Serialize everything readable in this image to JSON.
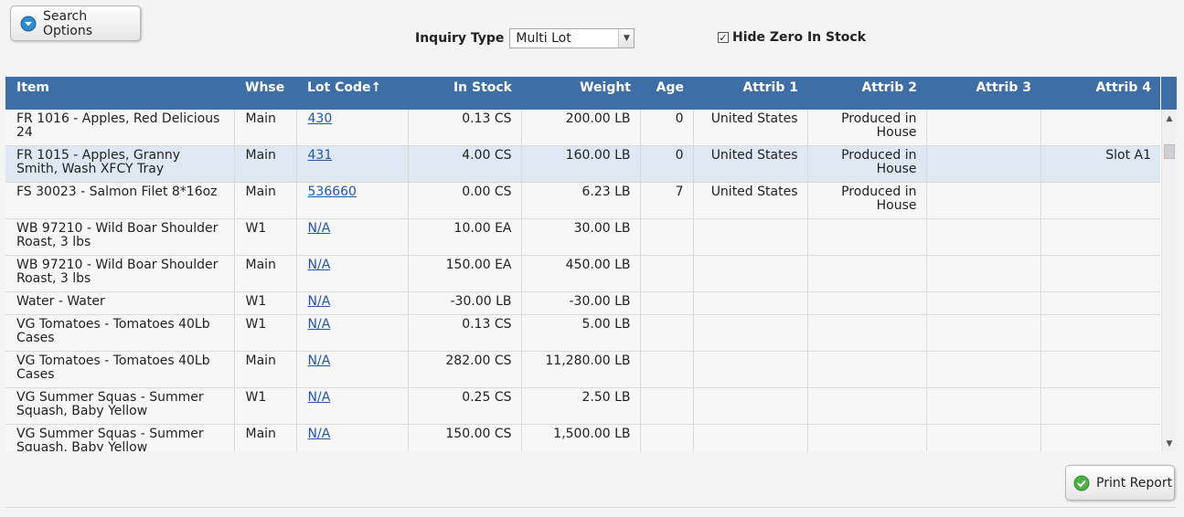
{
  "toolbar": {
    "search_options_label": "Search Options",
    "inquiry_type_label": "Inquiry Type",
    "inquiry_type_value": "Multi Lot",
    "hide_zero_label": "Hide Zero In Stock",
    "hide_zero_checked": true
  },
  "grid": {
    "columns": [
      "Item",
      "Whse",
      "Lot Code↑",
      "In Stock",
      "Weight",
      "Age",
      "Attrib 1",
      "Attrib 2",
      "Attrib 3",
      "Attrib 4"
    ],
    "rows": [
      {
        "item": "FR 1016 - Apples, Red Delicious 24",
        "whse": "Main",
        "lot": "430",
        "in_stock": "0.13 CS",
        "weight": "200.00 LB",
        "age": "0",
        "attrib1": "United States",
        "attrib2": "Produced in House",
        "attrib3": "",
        "attrib4": ""
      },
      {
        "item": "FR 1015 - Apples, Granny Smith, Wash XFCY Tray",
        "whse": "Main",
        "lot": "431",
        "in_stock": "4.00 CS",
        "weight": "160.00 LB",
        "age": "0",
        "attrib1": "United States",
        "attrib2": "Produced in House",
        "attrib3": "",
        "attrib4": "Slot A1"
      },
      {
        "item": "FS 30023 - Salmon Filet 8*16oz",
        "whse": "Main",
        "lot": "536660",
        "in_stock": "0.00 CS",
        "weight": "6.23 LB",
        "age": "7",
        "attrib1": "United States",
        "attrib2": "Produced in House",
        "attrib3": "",
        "attrib4": ""
      },
      {
        "item": "WB 97210 - Wild Boar Shoulder Roast, 3 lbs",
        "whse": "W1",
        "lot": "N/A",
        "in_stock": "10.00 EA",
        "weight": "30.00 LB",
        "age": "",
        "attrib1": "",
        "attrib2": "",
        "attrib3": "",
        "attrib4": ""
      },
      {
        "item": "WB 97210 - Wild Boar Shoulder Roast, 3 lbs",
        "whse": "Main",
        "lot": "N/A",
        "in_stock": "150.00 EA",
        "weight": "450.00 LB",
        "age": "",
        "attrib1": "",
        "attrib2": "",
        "attrib3": "",
        "attrib4": ""
      },
      {
        "item": "Water - Water",
        "whse": "W1",
        "lot": "N/A",
        "in_stock": "-30.00 LB",
        "weight": "-30.00 LB",
        "age": "",
        "attrib1": "",
        "attrib2": "",
        "attrib3": "",
        "attrib4": ""
      },
      {
        "item": "VG Tomatoes - Tomatoes 40Lb Cases",
        "whse": "W1",
        "lot": "N/A",
        "in_stock": "0.13 CS",
        "weight": "5.00 LB",
        "age": "",
        "attrib1": "",
        "attrib2": "",
        "attrib3": "",
        "attrib4": ""
      },
      {
        "item": "VG Tomatoes - Tomatoes 40Lb Cases",
        "whse": "Main",
        "lot": "N/A",
        "in_stock": "282.00 CS",
        "weight": "11,280.00 LB",
        "age": "",
        "attrib1": "",
        "attrib2": "",
        "attrib3": "",
        "attrib4": ""
      },
      {
        "item": "VG Summer Squas - Summer Squash, Baby Yellow",
        "whse": "W1",
        "lot": "N/A",
        "in_stock": "0.25 CS",
        "weight": "2.50 LB",
        "age": "",
        "attrib1": "",
        "attrib2": "",
        "attrib3": "",
        "attrib4": ""
      },
      {
        "item": "VG Summer Squas - Summer Squash, Baby Yellow",
        "whse": "Main",
        "lot": "N/A",
        "in_stock": "150.00 CS",
        "weight": "1,500.00 LB",
        "age": "",
        "attrib1": "",
        "attrib2": "",
        "attrib3": "",
        "attrib4": ""
      }
    ]
  },
  "footer": {
    "print_report_label": "Print Report"
  },
  "colors": {
    "header_bg": "#3d6fa6",
    "selected_row": "#dde8f3",
    "link": "#2456a6"
  }
}
